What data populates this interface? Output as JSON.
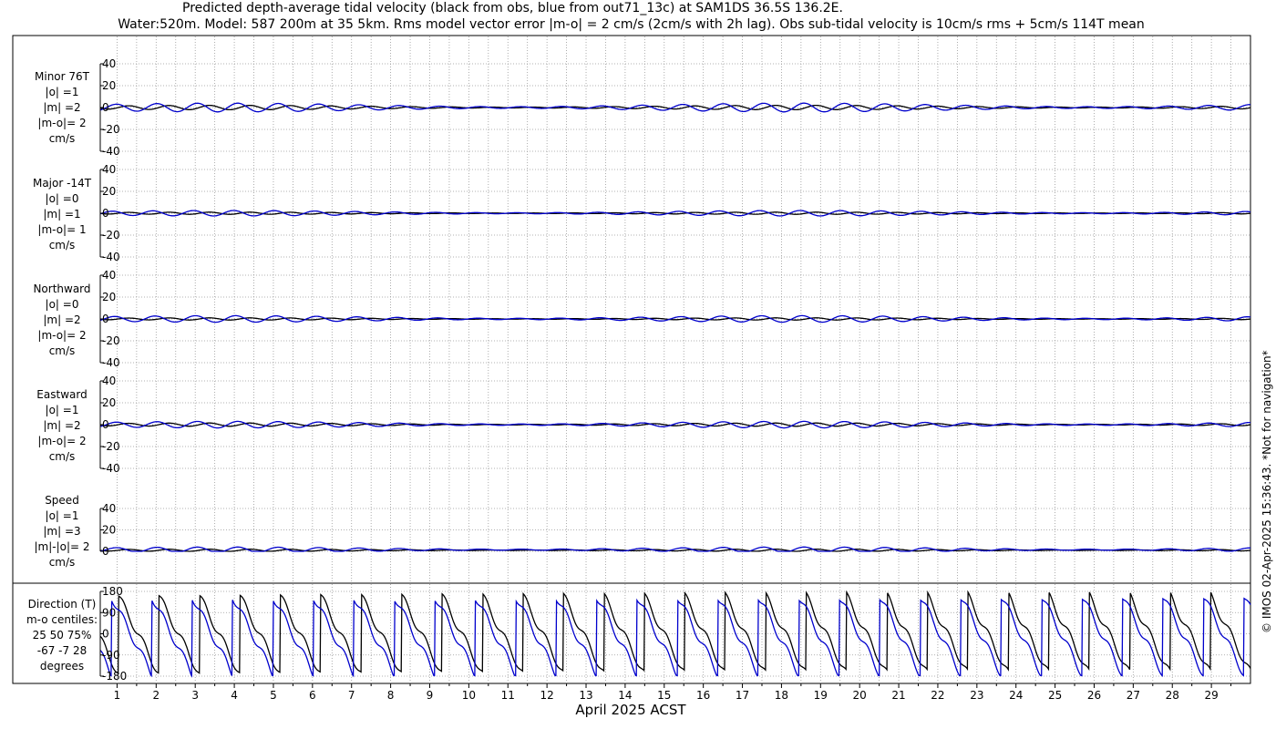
{
  "title_line1": "Predicted depth-average tidal velocity (black from obs, blue from out71_13c) at SAM1DS 36.5S 136.2E.",
  "title_line2": "Water:520m. Model: 587 200m at 35 5km. Rms model vector error |m-o| = 2 cm/s (2cm/s with 2h lag). Obs sub-tidal velocity is 10cm/s rms + 5cm/s 114T mean",
  "copyright": "© IMOS 02-Apr-2025 15:36:43. *Not for navigation*",
  "x_axis_label": "April 2025 ACST",
  "x_tick_labels": [
    "1",
    "2",
    "3",
    "4",
    "5",
    "6",
    "7",
    "8",
    "9",
    "10",
    "11",
    "12",
    "13",
    "14",
    "15",
    "16",
    "17",
    "18",
    "19",
    "20",
    "21",
    "22",
    "23",
    "24",
    "25",
    "26",
    "27",
    "28",
    "29"
  ],
  "colors": {
    "obs": "#000000",
    "model": "#0000cc",
    "grid": "#999999"
  },
  "chart_data": [
    {
      "type": "line",
      "title": "",
      "panel_labels": [
        "Minor 76T",
        "|o| =1",
        "|m| =2",
        "|m-o|= 2",
        "cm/s"
      ],
      "ylim": [
        -40,
        40
      ],
      "y_ticks": [
        "40",
        "20",
        "0",
        "-20",
        "-40"
      ],
      "series": [
        {
          "amp": 2,
          "phase": 0.0,
          "bias": 0
        },
        {
          "amp": 4,
          "phase": 0.3,
          "bias": 0
        }
      ]
    },
    {
      "type": "line",
      "title": "",
      "panel_labels": [
        "Major -14T",
        "|o| =0",
        "|m| =1",
        "|m-o|= 1",
        "cm/s"
      ],
      "ylim": [
        -40,
        40
      ],
      "y_ticks": [
        "40",
        "20",
        "0",
        "-20",
        "-40"
      ],
      "series": [
        {
          "amp": 1,
          "phase": 0.0,
          "bias": 0
        },
        {
          "amp": 2.5,
          "phase": 0.4,
          "bias": 0
        }
      ]
    },
    {
      "type": "line",
      "title": "",
      "panel_labels": [
        "Northward",
        "|o| =0",
        "|m| =2",
        "|m-o|= 2",
        "cm/s"
      ],
      "ylim": [
        -40,
        40
      ],
      "y_ticks": [
        "40",
        "20",
        "0",
        "-20",
        "-40"
      ],
      "series": [
        {
          "amp": 1,
          "phase": 0.0,
          "bias": 0
        },
        {
          "amp": 3,
          "phase": 0.35,
          "bias": 0
        }
      ]
    },
    {
      "type": "line",
      "title": "",
      "panel_labels": [
        "Eastward",
        "|o| =1",
        "|m| =2",
        "|m-o|= 2",
        "cm/s"
      ],
      "ylim": [
        -40,
        40
      ],
      "y_ticks": [
        "40",
        "20",
        "0",
        "-20",
        "-40"
      ],
      "series": [
        {
          "amp": 1.5,
          "phase": 0.0,
          "bias": 0
        },
        {
          "amp": 3,
          "phase": 0.3,
          "bias": 0
        }
      ]
    },
    {
      "type": "line",
      "title": "",
      "panel_labels": [
        "Speed",
        "|o| =1",
        "|m| =3",
        "|m|-|o|= 2",
        "cm/s"
      ],
      "ylim": [
        0,
        40
      ],
      "y_ticks": [
        "40",
        "20",
        "0"
      ],
      "series": [
        {
          "amp": 1,
          "phase": 0.0,
          "bias": 1
        },
        {
          "amp": 2.5,
          "phase": 0.3,
          "bias": 1.5
        }
      ]
    },
    {
      "type": "line",
      "title": "",
      "panel_labels": [
        "Direction (T)",
        "m-o centiles:",
        "25  50  75%",
        "-67  -7  28",
        "degrees"
      ],
      "ylim": [
        -180,
        180
      ],
      "y_ticks": [
        "180",
        "90",
        "0",
        "-90",
        "-180"
      ],
      "series": [
        {
          "phase": 0.0
        },
        {
          "phase": 0.18
        }
      ]
    }
  ]
}
